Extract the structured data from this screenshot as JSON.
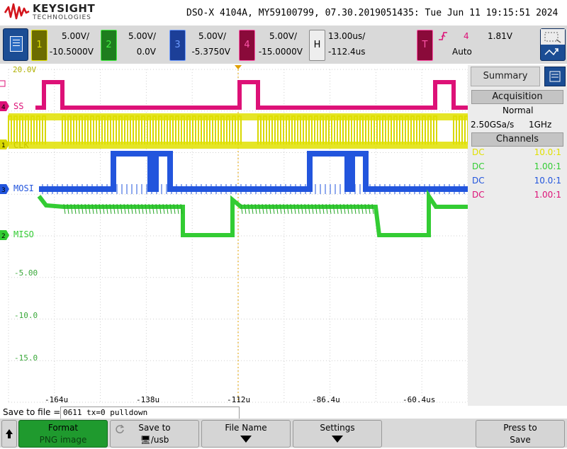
{
  "header": {
    "brand": "KEYSIGHT",
    "brand_sub": "TECHNOLOGIES",
    "instrument": "DSO-X 4104A, MY59100799, 07.30.2019051435: Tue Jun 11 19:15:51 2024"
  },
  "channels": [
    {
      "num": "1",
      "scale": "5.00V/",
      "offset": "-10.5000V",
      "color": "#e0e000",
      "badge_bg": "#6b6b00"
    },
    {
      "num": "2",
      "scale": "5.00V/",
      "offset": "0.0V",
      "color": "#33cc33",
      "badge_bg": "#1e7d1e"
    },
    {
      "num": "3",
      "scale": "5.00V/",
      "offset": "-5.3750V",
      "color": "#2255dd",
      "badge_bg": "#1c3f98"
    },
    {
      "num": "4",
      "scale": "5.00V/",
      "offset": "-15.0000V",
      "color": "#dd1177",
      "badge_bg": "#8a0a3a"
    }
  ],
  "horizontal": {
    "badge": "H",
    "scale": "13.00us/",
    "delay": "-112.4us"
  },
  "trigger": {
    "badge": "T",
    "source": "4",
    "level": "1.81V",
    "mode": "Auto",
    "slope_icon": "rising-edge"
  },
  "plot": {
    "top_label": "20.0V",
    "grid_labels": [
      "-5.00",
      "-10.0",
      "-15.0"
    ],
    "time_labels": [
      "-164u",
      "-138u",
      "-112u",
      "-86.4u",
      "-60.4us"
    ],
    "trace_labels": [
      {
        "text": "SS",
        "color": "#dd1177",
        "marker": "4"
      },
      {
        "text": "CLK",
        "color": "#e0e000",
        "marker": "1"
      },
      {
        "text": "MOSI",
        "color": "#2255dd",
        "marker": "3"
      },
      {
        "text": "MISO",
        "color": "#33cc33",
        "marker": "2"
      }
    ]
  },
  "sidebar": {
    "tab": "Summary",
    "acq_header": "Acquisition",
    "acq_mode": "Normal",
    "sample_rate": "2.50GSa/s",
    "bandwidth": "1GHz",
    "channels_header": "Channels",
    "channel_rows": [
      {
        "coupling": "DC",
        "ratio": "10.0:1",
        "color": "#e0e000"
      },
      {
        "coupling": "DC",
        "ratio": "1.00:1",
        "color": "#33cc33"
      },
      {
        "coupling": "DC",
        "ratio": "10.0:1",
        "color": "#2255dd"
      },
      {
        "coupling": "DC",
        "ratio": "1.00:1",
        "color": "#dd1177"
      }
    ]
  },
  "save": {
    "label": "Save to file =",
    "filename": "0611 tx=0 pulldown"
  },
  "softkeys": {
    "format": {
      "l1": "Format",
      "l2": "PNG image"
    },
    "saveto": {
      "l1": "Save to",
      "l2": "🖥/usb"
    },
    "filename": {
      "l1": "File Name"
    },
    "settings": {
      "l1": "Settings"
    },
    "press": {
      "l1": "Press to",
      "l2": "Save"
    }
  }
}
